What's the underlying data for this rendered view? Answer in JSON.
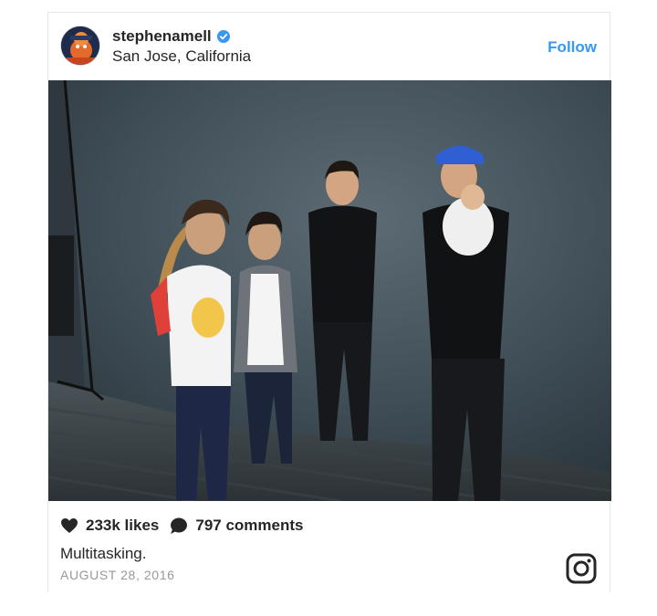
{
  "post": {
    "username": "stephenamell",
    "verified": true,
    "location": "San Jose, California",
    "follow_label": "Follow",
    "likes_label": "233k likes",
    "comments_label": "797 comments",
    "caption": "Multitasking.",
    "date": "AUGUST 28, 2016"
  },
  "icons": {
    "verified": "verified-badge-icon",
    "like": "heart-icon",
    "comment": "speech-bubble-icon",
    "brand": "instagram-logo-icon"
  },
  "colors": {
    "accent": "#3897f0",
    "text": "#262626",
    "muted": "#999999",
    "border": "#e6e6e6"
  }
}
